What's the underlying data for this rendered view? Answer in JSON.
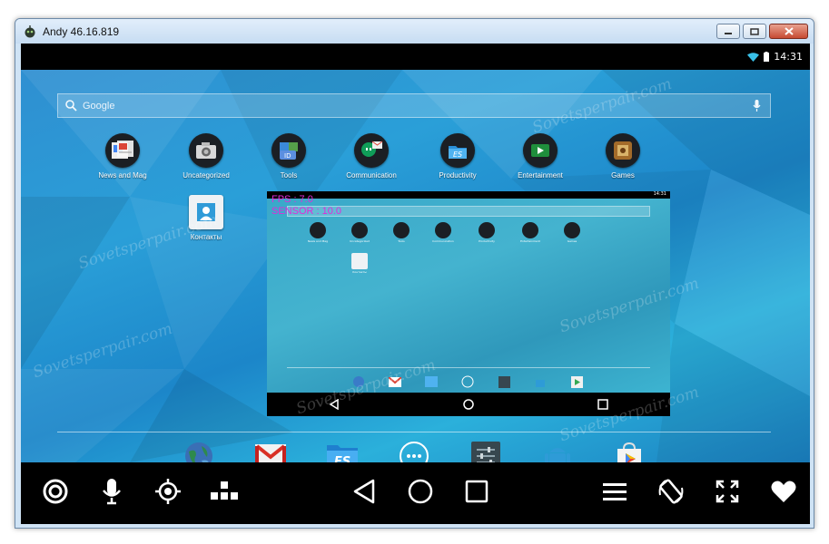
{
  "window": {
    "title": "Andy 46.16.819"
  },
  "status": {
    "time": "14:31"
  },
  "search": {
    "placeholder": "Google"
  },
  "apps": [
    {
      "label": "News and Mag",
      "icon": "newspaper-icon"
    },
    {
      "label": "Uncategorized",
      "icon": "camera-icon"
    },
    {
      "label": "Tools",
      "icon": "tools-icon"
    },
    {
      "label": "Communication",
      "icon": "hangouts-icon"
    },
    {
      "label": "Productivity",
      "icon": "es-file-explorer-icon"
    },
    {
      "label": "Entertainment",
      "icon": "video-icon"
    },
    {
      "label": "Games",
      "icon": "games-icon"
    },
    {
      "label": "Контакты",
      "icon": "contacts-icon"
    }
  ],
  "overlay": {
    "fps": "FPS : 7.0",
    "sensor": "SENSOR : 10.0"
  },
  "watermark": "Sovetsperpair.com",
  "dock": [
    "globe-icon",
    "gmail-icon",
    "es-file-explorer-icon",
    "app-drawer-icon",
    "settings-icon",
    "android-icon",
    "play-store-icon"
  ],
  "colors": {
    "accent_overlay": "#e22bd9",
    "desktop_blue": "#2a9fd8"
  }
}
